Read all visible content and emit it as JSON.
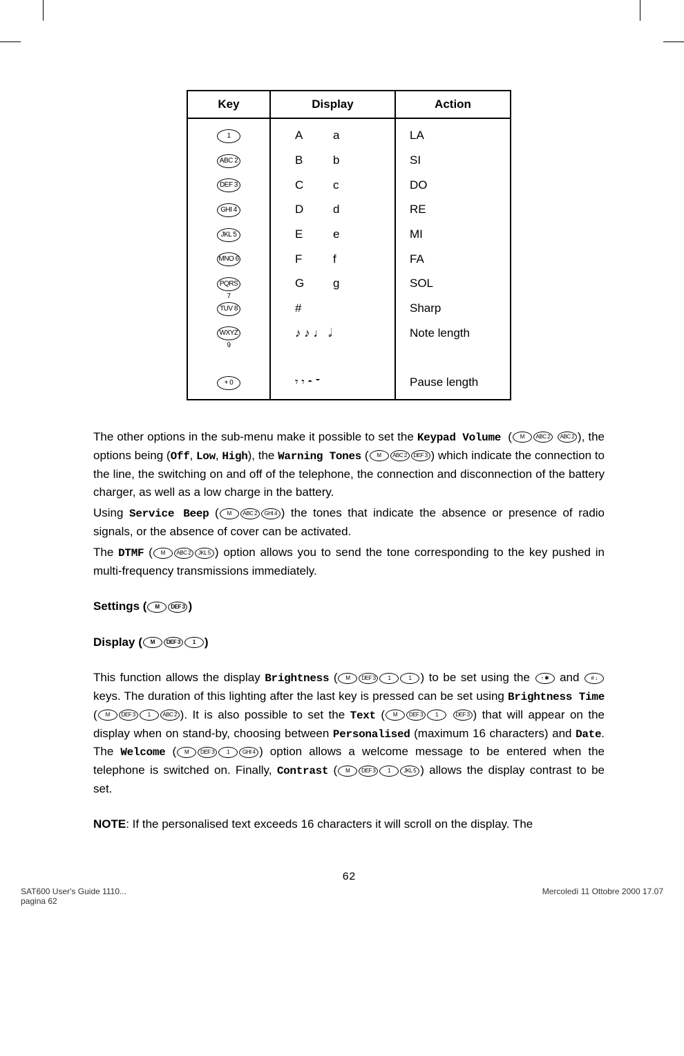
{
  "table": {
    "headers": {
      "key": "Key",
      "display": "Display",
      "action": "Action"
    },
    "rows": [
      {
        "keyLabel": "1",
        "dispU": "A",
        "dispL": "a",
        "action": "LA"
      },
      {
        "keyLabel": "ABC 2",
        "dispU": "B",
        "dispL": "b",
        "action": "SI"
      },
      {
        "keyLabel": "DEF 3",
        "dispU": "C",
        "dispL": "c",
        "action": "DO"
      },
      {
        "keyLabel": "GHI 4",
        "dispU": "D",
        "dispL": "d",
        "action": "RE"
      },
      {
        "keyLabel": "JKL 5",
        "dispU": "E",
        "dispL": "e",
        "action": "MI"
      },
      {
        "keyLabel": "MNO 6",
        "dispU": "F",
        "dispL": "f",
        "action": "FA"
      },
      {
        "keyLabel": "PQRS 7",
        "dispU": "G",
        "dispL": "g",
        "action": "SOL"
      },
      {
        "keyLabel": "TUV 8",
        "dispU": "#",
        "dispL": "",
        "action": "Sharp"
      },
      {
        "keyLabel": "WXYZ 9",
        "dispNotes": "♪ ♪ ♩ 𝅗𝅥",
        "action": "Note length"
      },
      {
        "keyLabel": "+ 0",
        "dispNotes": "𝄾 𝄾 𝄼 𝄻",
        "action": "Pause length"
      }
    ]
  },
  "keys": {
    "m": "M",
    "abc2": "ABC 2",
    "def3": "DEF 3",
    "ghi4": "GHI 4",
    "jkl5": "JKL 5",
    "one": "1",
    "star": "↑ ✱",
    "hash": "# ↓"
  },
  "text": {
    "p1a": "The other options in the sub-menu make it possible to set the ",
    "keypadVolume": "Keypad Volume",
    "p1b": "), the options being (",
    "off": "Off",
    "low": "Low",
    "high": "High",
    "p1c": "), the ",
    "warningTones": "Warning Tones",
    "p1d": ") which indicate the connection to the line, the switching on and off of the telephone, the connection and disconnection of the battery charger, as well as a low charge in the battery.",
    "p2a": "Using ",
    "serviceBeep": "Service Beep",
    "p2b": ") the tones that indicate the absence or presence of radio signals, or the absence of cover can be activated.",
    "p3a": "The ",
    "dtmf": "DTMF",
    "p3b": ") option allows you to send the tone corresponding to the key pushed in multi-frequency transmissions immediately.",
    "settingsHeading": "Settings (",
    "displayHeading": "Display (",
    "p4a": "This function allows the display ",
    "brightness": "Brightness",
    "p4b": ") to be set using the ",
    "p4c": " and ",
    "p4d": " keys. The duration of this lighting after the last key is pressed can be set using ",
    "brightnessTime": "Brightness Time",
    "p4e": "). It is also possible to set the ",
    "textLabel": "Text",
    "p4f": ") that will appear on the display when on stand-by, choosing between ",
    "personalised": "Personalised",
    "p4g": " (maximum 16 characters) and ",
    "date": "Date",
    "p4h": ". The ",
    "welcome": "Welcome",
    "p4i": ") option allows a welcome message to be entered when the telephone is switched on. Finally, ",
    "contrast": "Contrast",
    "p4j": ") allows the display contrast to be set.",
    "noteLabel": "NOTE",
    "noteText": ": If the personalised text exceeds 16 characters it will scroll on the display. The"
  },
  "pageNum": "62",
  "footer": {
    "left1": "SAT600 User's Guide 1110...",
    "left2": "pagina 62",
    "right": "Mercoledì 11 Ottobre 2000 17.07"
  }
}
